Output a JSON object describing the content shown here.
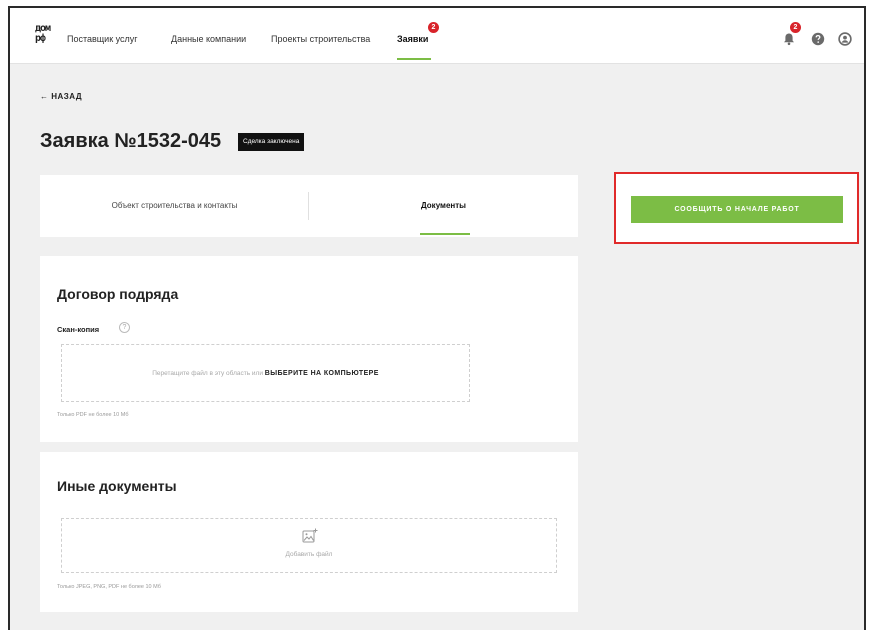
{
  "header": {
    "logo": [
      "дом",
      "рф"
    ],
    "nav": [
      {
        "label": "Поставщик услуг"
      },
      {
        "label": "Данные компании"
      },
      {
        "label": "Проекты строительства"
      },
      {
        "label": "Заявки",
        "badge": "2",
        "active": true
      }
    ],
    "notifications_badge": "2",
    "icons": [
      "bell-icon",
      "help-icon",
      "user-icon"
    ]
  },
  "back": {
    "label": "← НАЗАД"
  },
  "request": {
    "title": "Заявка №1532-045",
    "status": "Сделка заключена"
  },
  "tabs": [
    {
      "label": "Объект строительства и контакты",
      "active": false
    },
    {
      "label": "Документы",
      "active": true
    }
  ],
  "report_button": {
    "label": "СООБЩИТЬ О НАЧАЛЕ РАБОТ"
  },
  "contract": {
    "title": "Договор подряда",
    "scan_label": "Скан-копия",
    "drop_prefix": "Перетащите файл в эту область или",
    "drop_link": "ВЫБЕРИТЕ НА КОМПЬЮТЕРЕ",
    "hint": "Только PDF не более 10 Мб"
  },
  "other_docs": {
    "title": "Иные документы",
    "add_file": "Добавить файл",
    "hint": "Только JPEG, PNG, PDF не более 10 Мб"
  },
  "colors": {
    "accent": "#7cbd45",
    "badge": "#d8232a",
    "highlight_frame": "#e02a2a",
    "status_badge": "#111111"
  }
}
